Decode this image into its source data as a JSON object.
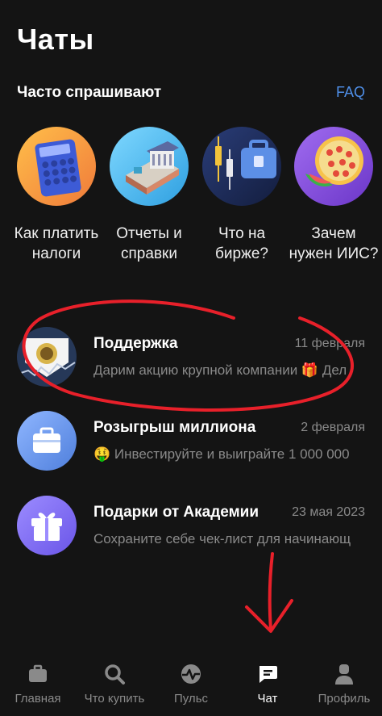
{
  "header": {
    "title": "Чаты"
  },
  "faq": {
    "heading": "Часто спрашивают",
    "link": "FAQ",
    "items": [
      {
        "label": "Как платить налоги",
        "icon": "calculator-icon"
      },
      {
        "label": "Отчеты и справки",
        "icon": "bank-building-icon"
      },
      {
        "label": "Что на бирже?",
        "icon": "briefcase-chart-icon"
      },
      {
        "label": "Зачем нужен ИИС?",
        "icon": "pizza-icon"
      }
    ]
  },
  "chats": [
    {
      "name": "Поддержка",
      "date": "11 февраля",
      "preview": "Дарим акцию крупной компании 🎁 Дел",
      "icon": "bank-logo-icon"
    },
    {
      "name": "Розыгрыш миллиона",
      "date": "2 февраля",
      "preview": "🤑 Инвестируйте и выиграйте 1 000 000",
      "icon": "briefcase-icon"
    },
    {
      "name": "Подарки от Академии",
      "date": "23 мая 2023",
      "preview": "Сохраните себе чек-лист для начинающ",
      "icon": "gift-icon"
    }
  ],
  "nav": {
    "items": [
      {
        "label": "Главная",
        "icon": "briefcase-icon",
        "active": false
      },
      {
        "label": "Что купить",
        "icon": "search-icon",
        "active": false
      },
      {
        "label": "Пульс",
        "icon": "pulse-icon",
        "active": false
      },
      {
        "label": "Чат",
        "icon": "chat-icon",
        "active": true
      },
      {
        "label": "Профиль",
        "icon": "profile-icon",
        "active": false
      }
    ]
  },
  "colors": {
    "background": "#141414",
    "accent": "#4f8fe8",
    "muted": "#8a8a8a",
    "annotation": "#e8202a"
  }
}
